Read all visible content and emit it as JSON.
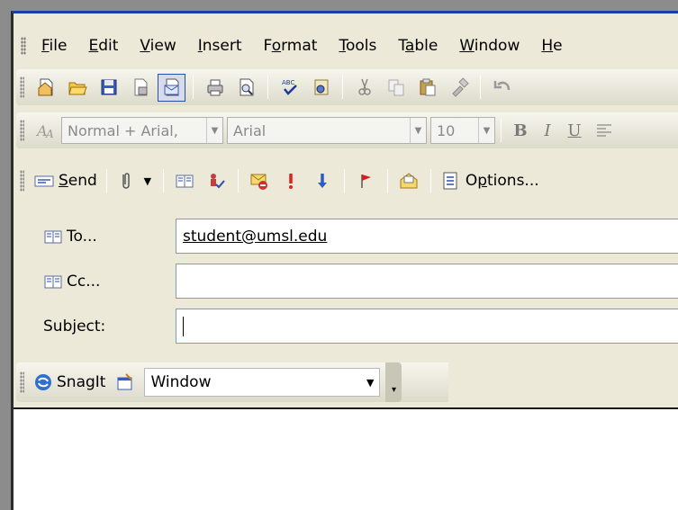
{
  "menu": {
    "items": [
      {
        "label_pre": "",
        "accel": "F",
        "label_post": "ile"
      },
      {
        "label_pre": "E",
        "accel": "",
        "label_post": "dit"
      },
      {
        "label_pre": "",
        "accel": "V",
        "label_post": "iew"
      },
      {
        "label_pre": "",
        "accel": "I",
        "label_post": "nsert"
      },
      {
        "label_pre": "F",
        "accel": "o",
        "label_post": "rmat"
      },
      {
        "label_pre": "",
        "accel": "T",
        "label_post": "ools"
      },
      {
        "label_pre": "T",
        "accel": "a",
        "label_post": "ble"
      },
      {
        "label_pre": "",
        "accel": "W",
        "label_post": "indow"
      },
      {
        "label_pre": "",
        "accel": "H",
        "label_post": "e"
      }
    ]
  },
  "formatting": {
    "style_value": "Normal + Arial,",
    "font_value": "Arial",
    "size_value": "10",
    "bold_label": "B",
    "italic_label": "I",
    "underline_label": "U"
  },
  "email_toolbar": {
    "send_accel": "S",
    "send_rest": "end",
    "options_pre": "O",
    "options_accel": "p",
    "options_rest": "tions..."
  },
  "header": {
    "to_label": "To...",
    "to_value": "student@umsl.edu",
    "cc_label": "Cc...",
    "cc_value": "",
    "subject_label": "Subject:",
    "subject_value": ""
  },
  "snagit": {
    "label": "SnagIt",
    "capture_mode": "Window"
  },
  "colors": {
    "window_title_blue": "#1b3fa3",
    "toolbar_bg": "#ece9d8",
    "input_border": "#7f9db9"
  }
}
